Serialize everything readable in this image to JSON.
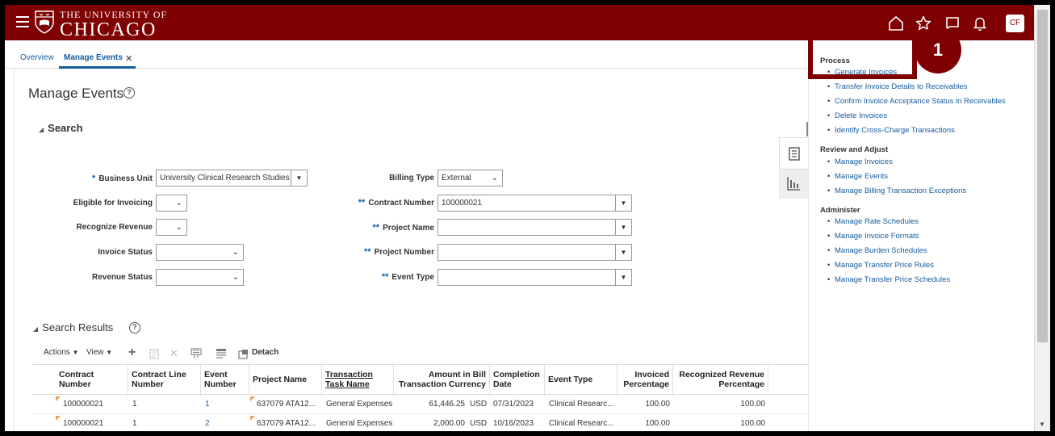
{
  "header": {
    "brand_line1": "THE UNIVERSITY OF",
    "brand_line2": "CHICAGO",
    "avatar": "CF",
    "icons": [
      "home-icon",
      "star-icon",
      "flag-icon",
      "bell-icon"
    ]
  },
  "tabs": [
    {
      "label": "Overview"
    },
    {
      "label": "Manage Events"
    }
  ],
  "page": {
    "title": "Manage Events",
    "search_label": "Search",
    "results_label": "Search Results"
  },
  "form": {
    "business_unit": {
      "label": "Business Unit",
      "value": "University Clinical Research Studies",
      "req": "*"
    },
    "eligible_invoicing": {
      "label": "Eligible for Invoicing",
      "value": ""
    },
    "recognize_revenue": {
      "label": "Recognize Revenue",
      "value": ""
    },
    "invoice_status": {
      "label": "Invoice Status",
      "value": ""
    },
    "revenue_status": {
      "label": "Revenue Status",
      "value": ""
    },
    "billing_type": {
      "label": "Billing Type",
      "value": "External"
    },
    "contract_number": {
      "label": "Contract Number",
      "value": "100000021",
      "req": "**"
    },
    "project_name": {
      "label": "Project Name",
      "value": "",
      "req": "**"
    },
    "project_number": {
      "label": "Project Number",
      "value": "",
      "req": "**"
    },
    "event_type": {
      "label": "Event Type",
      "value": "",
      "req": "**"
    }
  },
  "toolbar": {
    "actions": "Actions",
    "view": "View",
    "detach": "Detach"
  },
  "table": {
    "headers": {
      "contract_number": "Contract Number",
      "contract_line": "Contract Line Number",
      "event_number": "Event Number",
      "project_name": "Project Name",
      "task_name": "Transaction Task Name",
      "amount": "Amount in Bill Transaction Currency",
      "completion": "Completion Date",
      "event_type": "Event Type",
      "invoiced": "Invoiced Percentage",
      "recognized": "Recognized Revenue Percentage"
    },
    "rows": [
      {
        "contract_number": "100000021",
        "contract_line": "1",
        "event_number": "1",
        "project_name": "637079 ATA12...",
        "task_name": "General Expenses",
        "amount": "61,446.25",
        "currency": "USD",
        "completion": "07/31/2023",
        "event_type": "Clinical Researc...",
        "invoiced": "100.00",
        "recognized": "100.00"
      },
      {
        "contract_number": "100000021",
        "contract_line": "1",
        "event_number": "2",
        "project_name": "637079 ATA12...",
        "task_name": "General Expenses",
        "amount": "2,000.00",
        "currency": "USD",
        "completion": "10/16/2023",
        "event_type": "Clinical Researc...",
        "invoiced": "100.00",
        "recognized": "100.00"
      }
    ]
  },
  "panel": {
    "process": {
      "heading": "Process",
      "items": [
        "Generate Invoices",
        "Transfer Invoice Details to Receivables",
        "Confirm Invoice Acceptance Status in Receivables",
        "Delete Invoices",
        "Identify Cross-Charge Transactions"
      ]
    },
    "review": {
      "heading": "Review and Adjust",
      "items": [
        "Manage Invoices",
        "Manage Events",
        "Manage Billing Transaction Exceptions"
      ]
    },
    "administer": {
      "heading": "Administer",
      "items": [
        "Manage Rate Schedules",
        "Manage Invoice Formats",
        "Manage Burden Schedules",
        "Manage Transfer Price Rules",
        "Manage Transfer Price Schedules"
      ]
    }
  },
  "callout": {
    "number": "1"
  }
}
